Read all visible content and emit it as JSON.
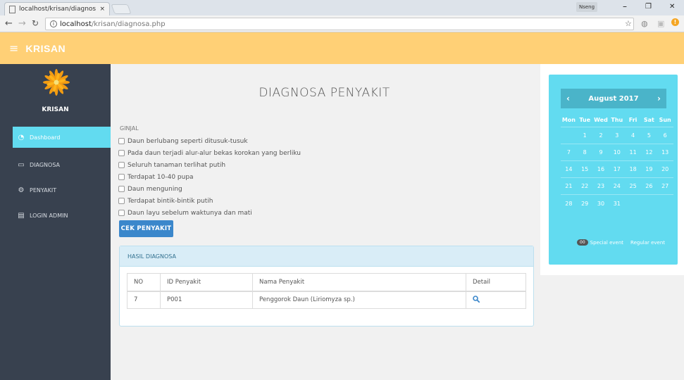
{
  "browser": {
    "tab_title": "localhost/krisan/diagnos",
    "tab_close": "×",
    "profile_label": "Nseng",
    "win_min": "–",
    "win_max": "❐",
    "win_close": "✕",
    "url_host": "localhost",
    "url_path": "/krisan/diagnosa.php"
  },
  "header": {
    "brand": "KRISAN"
  },
  "sidebar": {
    "brand": "KRISAN",
    "items": [
      {
        "label": "Dashboard",
        "icon": "dashboard-icon",
        "active": true
      },
      {
        "label": "DIAGNOSA",
        "icon": "monitor-icon",
        "active": false
      },
      {
        "label": "PENYAKIT",
        "icon": "gears-icon",
        "active": false
      },
      {
        "label": "LOGIN ADMIN",
        "icon": "book-icon",
        "active": false
      }
    ]
  },
  "main": {
    "title": "DIAGNOSA PENYAKIT",
    "group_label": "GINJAL",
    "symptoms": [
      "Daun berlubang seperti ditusuk-tusuk",
      "Pada daun terjadi alur-alur bekas korokan yang berliku",
      "Seluruh tanaman terlihat putih",
      "Terdapat 10-40 pupa",
      "Daun menguning",
      "Terdapat bintik-bintik putih",
      "Daun layu sebelum waktunya dan mati"
    ],
    "submit_label": "CEK PENYAKIT",
    "result": {
      "heading": "HASIL DIAGNOSA",
      "columns": [
        "NO",
        "ID Penyakit",
        "Nama Penyakit",
        "Detail"
      ],
      "rows": [
        {
          "no": "7",
          "id": "P001",
          "name": "Penggorok Daun (Liriomyza sp.)"
        }
      ]
    }
  },
  "calendar": {
    "month": "August 2017",
    "prev": "‹",
    "next": "›",
    "weekdays": [
      "Mon",
      "Tue",
      "Wed",
      "Thu",
      "Fri",
      "Sat",
      "Sun"
    ],
    "weeks": [
      [
        "",
        "1",
        "2",
        "3",
        "4",
        "5",
        "6"
      ],
      [
        "7",
        "8",
        "9",
        "10",
        "11",
        "12",
        "13"
      ],
      [
        "14",
        "15",
        "16",
        "17",
        "18",
        "19",
        "20"
      ],
      [
        "21",
        "22",
        "23",
        "24",
        "25",
        "26",
        "27"
      ],
      [
        "28",
        "29",
        "30",
        "31",
        "",
        "",
        ""
      ]
    ],
    "legend_pill": "00",
    "legend_special": "Special event",
    "legend_regular": "Regular event"
  },
  "colors": {
    "header": "#ffd076",
    "sidebar": "#38414f",
    "sidebar_active": "#62dbf0",
    "calendar": "#62dbf0",
    "calendar_header": "#4ab4c9",
    "button": "#3b87cb"
  }
}
